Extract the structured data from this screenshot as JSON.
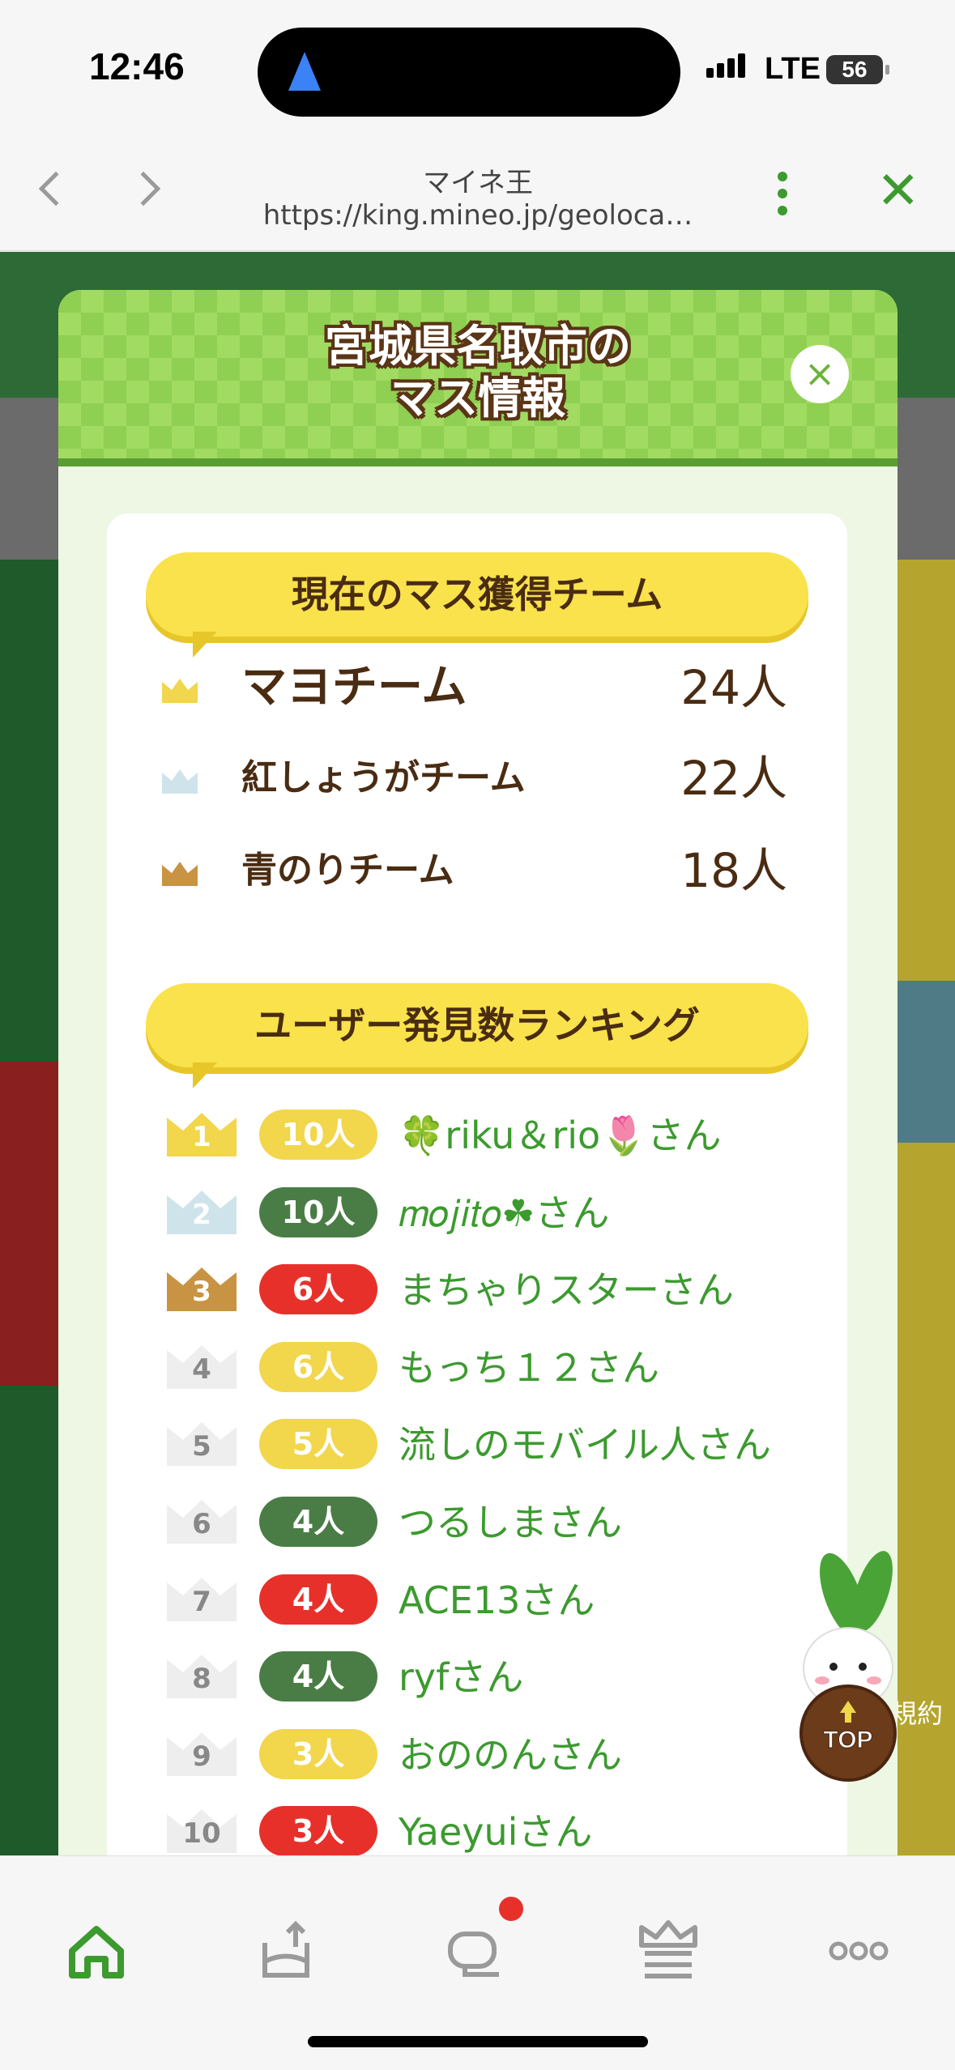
{
  "status_bar": {
    "time": "12:46",
    "network": "LTE",
    "battery": "56"
  },
  "browser": {
    "title": "マイネ王",
    "url": "https://king.mineo.jp/geoloca…"
  },
  "modal": {
    "title_line1": "宮城県名取市の",
    "title_line2": "マス情報",
    "close_symbol": "×"
  },
  "teams_section": {
    "heading": "現在のマス獲得チーム",
    "teams": [
      {
        "name": "マヨチーム",
        "count": "24人",
        "crown_color": "#f2d64b"
      },
      {
        "name": "紅しょうがチーム",
        "count": "22人",
        "crown_color": "#cfe4ea"
      },
      {
        "name": "青のりチーム",
        "count": "18人",
        "crown_color": "#c89443"
      }
    ]
  },
  "ranking_section": {
    "heading": "ユーザー発見数ランキング",
    "rows": [
      {
        "rank": "1",
        "count": "10人",
        "name": "🍀riku＆rio🌷さん",
        "pill_color": "#f2d64b",
        "crown_color": "#f2d64b"
      },
      {
        "rank": "2",
        "count": "10人",
        "name": "𝑚𝑜𝑗𝑖𝑡𝑜☘さん",
        "pill_color": "#4a7d46",
        "crown_color": "#cfe4ea"
      },
      {
        "rank": "3",
        "count": "6人",
        "name": "まちゃりスターさん",
        "pill_color": "#e8302a",
        "crown_color": "#c89443"
      },
      {
        "rank": "4",
        "count": "6人",
        "name": "もっち１２さん",
        "pill_color": "#f2d64b",
        "crown_color": "#eeeeee"
      },
      {
        "rank": "5",
        "count": "5人",
        "name": "流しのモバイル人さん",
        "pill_color": "#f2d64b",
        "crown_color": "#eeeeee"
      },
      {
        "rank": "6",
        "count": "4人",
        "name": "つるしまさん",
        "pill_color": "#4a7d46",
        "crown_color": "#eeeeee"
      },
      {
        "rank": "7",
        "count": "4人",
        "name": "ACE13さん",
        "pill_color": "#e8302a",
        "crown_color": "#eeeeee"
      },
      {
        "rank": "8",
        "count": "4人",
        "name": "ryfさん",
        "pill_color": "#4a7d46",
        "crown_color": "#eeeeee"
      },
      {
        "rank": "9",
        "count": "3人",
        "name": "おののんさん",
        "pill_color": "#f2d64b",
        "crown_color": "#eeeeee"
      },
      {
        "rank": "10",
        "count": "3人",
        "name": "Yaeyuiさん",
        "pill_color": "#e8302a",
        "crown_color": "#eeeeee"
      }
    ]
  },
  "mascot": {
    "label": "TOP"
  },
  "background_page": {
    "footer_right_text": "規約"
  },
  "tab_bar": {
    "tabs": [
      {
        "icon": "home-icon",
        "active": true
      },
      {
        "icon": "upload-tray-icon",
        "active": false
      },
      {
        "icon": "chat-icon",
        "active": false,
        "badge": true
      },
      {
        "icon": "crown-ranking-icon",
        "active": false
      },
      {
        "icon": "more-icon",
        "active": false
      }
    ]
  }
}
